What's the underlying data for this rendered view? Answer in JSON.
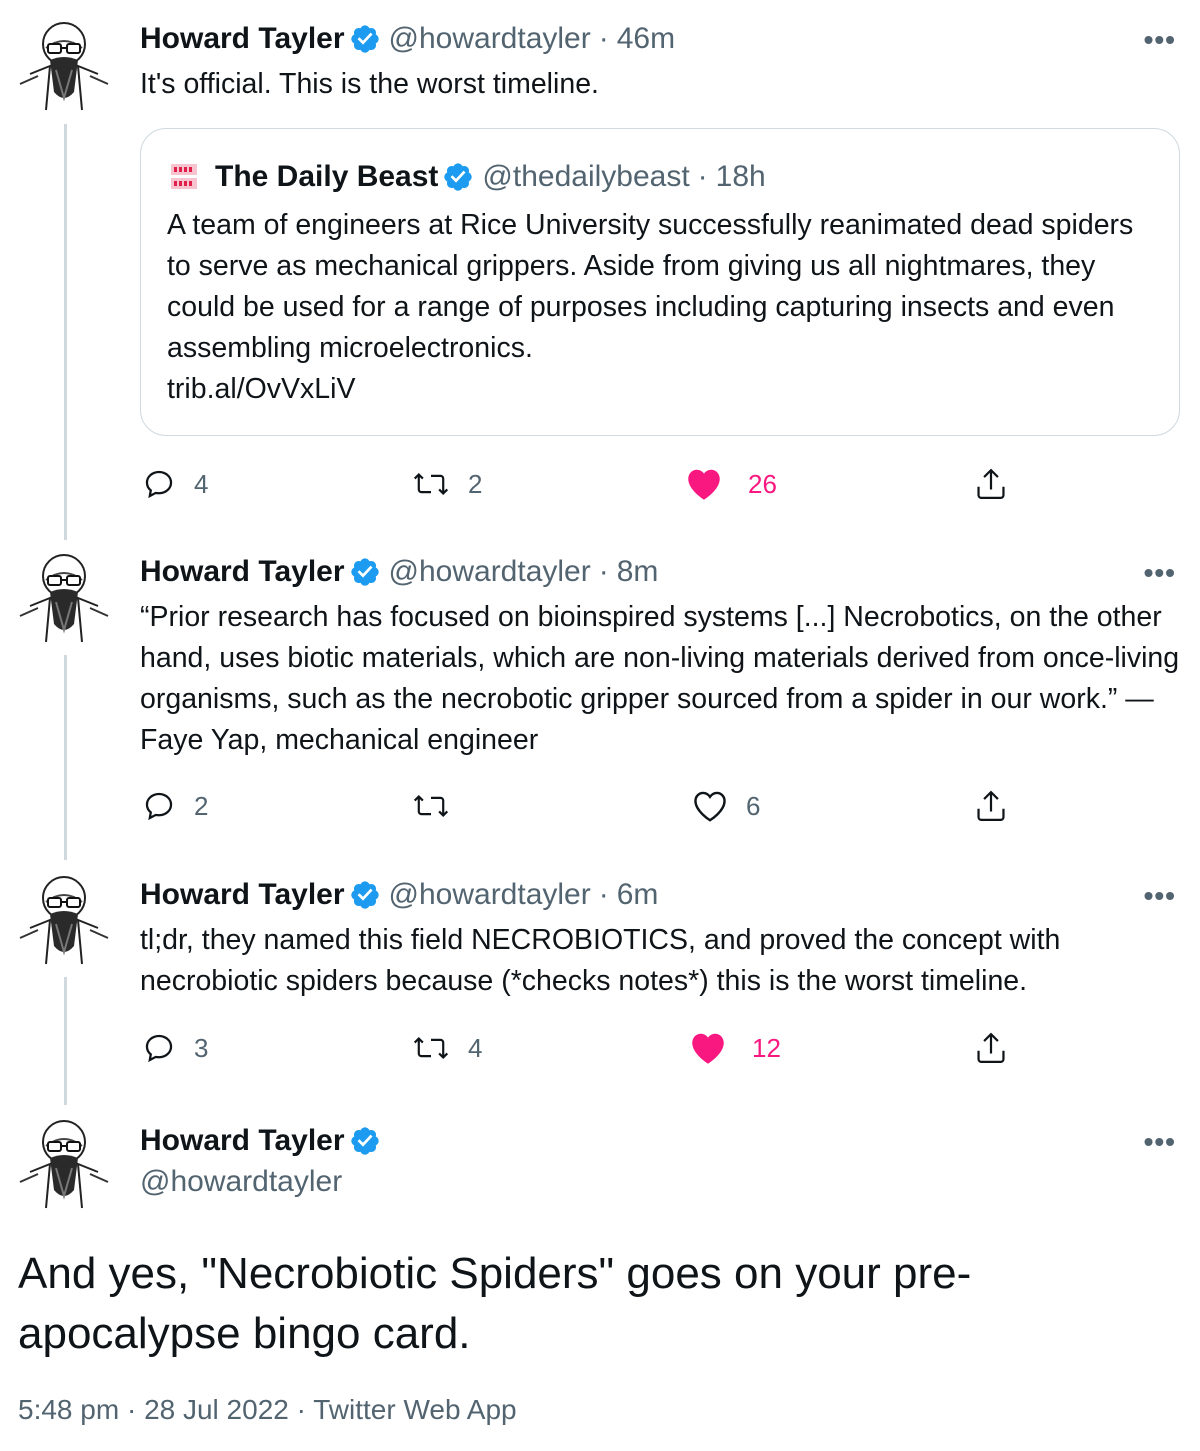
{
  "tweets": [
    {
      "name": "Howard Tayler",
      "handle": "@howardtayler",
      "sep": "·",
      "time": "46m",
      "more": "•••",
      "text": "It's official. This is the worst timeline.",
      "quote": {
        "name": "The Daily Beast",
        "handle": "@thedailybeast",
        "sep": "·",
        "time": "18h",
        "text": "A team of engineers at Rice University successfully reanimated dead spiders to serve as mechanical grippers. Aside from giving us all nightmares, they could be used for a range of purposes including capturing insects and even assembling microelectronics.",
        "link": "trib.al/OvVxLiV"
      },
      "replies": "4",
      "retweets": "2",
      "likes": "26",
      "liked": true
    },
    {
      "name": "Howard Tayler",
      "handle": "@howardtayler",
      "sep": "·",
      "time": "8m",
      "more": "•••",
      "text": "“Prior research has focused on bioinspired systems [...] Necrobotics, on the other hand, uses biotic materials, which are non-living materials derived from once-living organisms, such as the necrobotic gripper sourced from a spider in our work.” — Faye Yap, mechanical engineer",
      "replies": "2",
      "retweets": "",
      "likes": "6",
      "liked": false
    },
    {
      "name": "Howard Tayler",
      "handle": "@howardtayler",
      "sep": "·",
      "time": "6m",
      "more": "•••",
      "text": "tl;dr, they named this field NECROBIOTICS, and proved the concept with necrobiotic spiders because (*checks notes*) this is the worst timeline.",
      "replies": "3",
      "retweets": "4",
      "likes": "12",
      "liked": true
    }
  ],
  "main_tweet": {
    "name": "Howard Tayler",
    "handle": "@howardtayler",
    "more": "•••",
    "text": "And yes, \"Necrobiotic Spiders\" goes on your pre-apocalypse bingo card.",
    "time": "5:48 pm",
    "sep": "·",
    "date": "28 Jul 2022",
    "source": "Twitter Web App"
  },
  "colors": {
    "verified": "#1d9bf0",
    "like": "#f91880",
    "secondary_text": "#536471",
    "thread_line": "#cfd9de",
    "quote_logo": "#e0204a"
  },
  "icons": [
    "verified-badge-icon",
    "reply-icon",
    "retweet-icon",
    "heart-icon",
    "share-icon",
    "more-icon",
    "daily-beast-logo"
  ]
}
